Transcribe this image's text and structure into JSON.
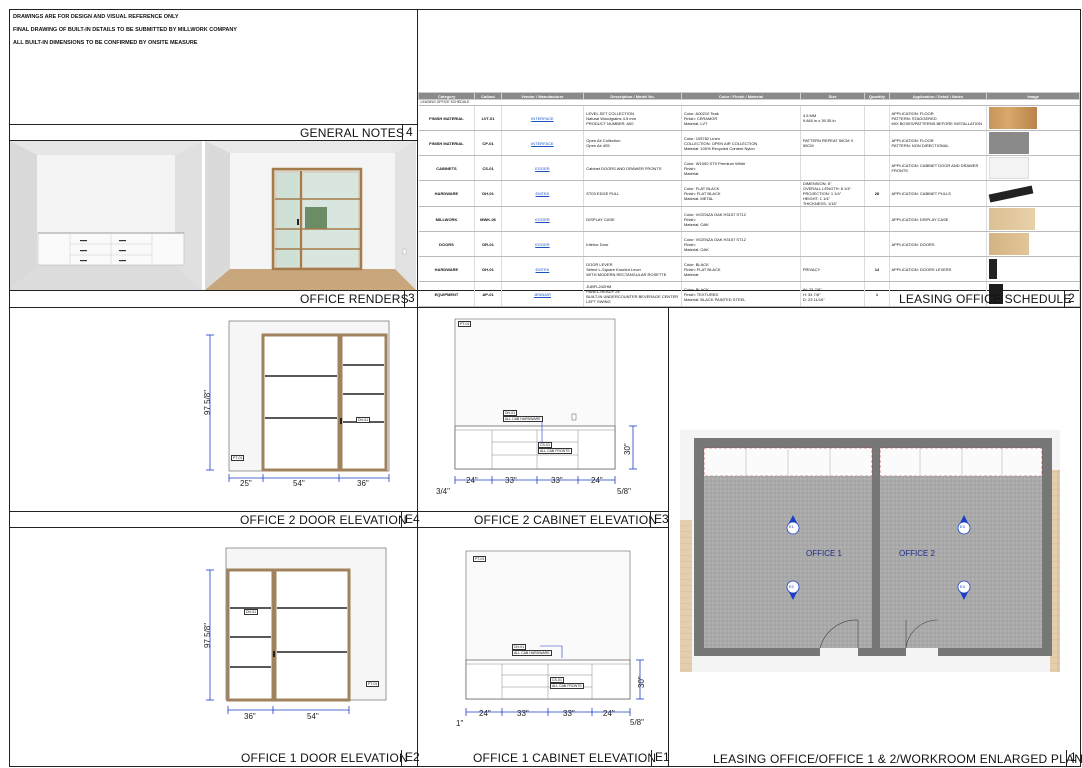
{
  "notes": {
    "line1": "DRAWINGS ARE FOR DESIGN AND VISUAL REFERENCE ONLY",
    "line2": "FINAL DRAWING OF BUILT-IN DETAILS TO BE SUBMITTED BY MILLWORK COMPANY",
    "line3": "ALL BUILT-IN DIMENSIONS TO BE CONFIRMED BY ONSITE MEASURE"
  },
  "panels": {
    "general_notes": {
      "title": "GENERAL NOTES",
      "num": "4"
    },
    "renders": {
      "title": "OFFICE RENDERS",
      "num": "3"
    },
    "schedule": {
      "title": "LEASING OFFICE SCHEDULE",
      "num": "2"
    },
    "o2_door": {
      "title": "OFFICE 2 DOOR ELEVATION",
      "num": "E4"
    },
    "o2_cab": {
      "title": "OFFICE 2 CABINET ELEVATION",
      "num": "E3"
    },
    "o1_door": {
      "title": "OFFICE 1 DOOR ELEVATION",
      "num": "E2"
    },
    "o1_cab": {
      "title": "OFFICE 1 CABINET ELEVATION",
      "num": "E1"
    },
    "plan": {
      "title": "LEASING OFFICE/OFFICE 1 & 2/WORKROOM ENLARGED PLAN",
      "num": "1"
    }
  },
  "schedule": {
    "headers": [
      "Category",
      "Callout",
      "Vendor / Manufacturer",
      "Description / Model No.",
      "Color / Finish / Material",
      "Size",
      "Quantity",
      "Application / Detail / Notes",
      "Image"
    ],
    "subtitle": "LEASING OFFICE SCHEDULE",
    "rows": [
      {
        "cat": "FINISH MATERIAL",
        "callout": "LVT-01",
        "vendor": "INTERFACE",
        "desc": "LEVEL SET COLLECTION\nNatural Woodgrains 4.5 mm\nPRODUCT NUMBER: A00",
        "color": "Color: A00210 Teak\nFinish: CERAMGR\nMaterial: LVT",
        "size": "4.5 MM\n9.845 in x 39.35 in",
        "qty": "",
        "notes": "APPLICATION: FLOOR\nPATTERN: STAGGERED\nMIX BOXES/PATTERNS BEFORE INSTALLATION",
        "img": "wood"
      },
      {
        "cat": "FINISH MATERIAL",
        "callout": "CP-01",
        "vendor": "INTERFACE",
        "desc": "Open Air Collection\nOpen Air 405",
        "color": "Color: 105782 Linen\nCOLLECTION: OPEN AIR COLLECTION\nMaterial: 100% Recycled Content Nylon",
        "size": "PATTERN REPEAT 50CM X 50CM",
        "qty": "",
        "notes": "APPLICATION: FLOOR\nPATTERN: NON DIRECTIONAL",
        "img": "carpet"
      },
      {
        "cat": "CABINETS",
        "callout": "CS-01",
        "vendor": "EGGER",
        "desc": "Cabinet DOORS AND DRAWER FRONTS",
        "color": "Color: W1000 ST9 Premium White\nFinish:\nMaterial:",
        "size": "",
        "qty": "",
        "notes": "APPLICATION: CABINET DOOR AND DRAWER FRONTS",
        "img": "white"
      },
      {
        "cat": "HARDWARE",
        "callout": "DH-01",
        "vendor": "EMTEK",
        "desc": "ST03 EDGE PULL",
        "color": "Color: FLAT BLACK\nFinish: FLAT BLACK\nMaterial: METAL",
        "size": "DIMENSION: 8\"\nOVERALL LENGTH: 8 1/4\"\nPROJECTION: 1 1/4\"\nHEIGHT: 1 1/4\"\nTHICKNESS: 1/16\"",
        "qty": "28",
        "notes": "APPLICATION: CABINET PULLS",
        "img": "pull"
      },
      {
        "cat": "MILLWORK",
        "callout": "MWK-06",
        "vendor": "EGGER",
        "desc": "DISPLAY CASE",
        "color": "Color: VICENZA OAK H3157 ST12\nFinish:\nMaterial: OAK",
        "size": "",
        "qty": "",
        "notes": "APPLICATION: DISPLAY CASE",
        "img": "oak"
      },
      {
        "cat": "DOORS",
        "callout": "DR-01",
        "vendor": "EGGER",
        "desc": "Interior Door",
        "color": "Color: VICENZA OAK H3157 ST12\nFinish:\nMaterial: OAK",
        "size": "",
        "qty": "",
        "notes": "APPLICATION: DOORS",
        "img": "oak2"
      },
      {
        "cat": "HARDWARE",
        "callout": "DH-01",
        "vendor": "EMTEK",
        "desc": "DOOR LEVER\nSelect L-Square Knurled Lever\nWITH MODERN RECTANGULAR ROSETTE",
        "color": "Color: BLACK\nFinish: FLAT BLACK\nMaterial:",
        "size": "PRIVACY",
        "qty": "14",
        "notes": "APPLICATION: DOORS LEVERS",
        "img": "lever"
      },
      {
        "cat": "EQUIPMENT",
        "callout": "AP-01",
        "vendor": "JENNAIR",
        "desc": "JUBFL242HM\nPANEL-READY 24\"\nBUILT-IN UNDERCOUNTER BEVERAGE CENTER\nLEFT SWING",
        "color": "Color: BLACK\nFinish: TEXTURED\nMaterial: BLACK PAINTED STEEL",
        "size": "W: 23-7/8\"\nH: 34 7/8\"\nD: 23 11/16\"",
        "qty": "1",
        "notes": "",
        "img": "fridge"
      }
    ]
  },
  "o2_door": {
    "height": "97 5/8\"",
    "d1": "25\"",
    "d2": "54\"",
    "d3": "36\"",
    "tag": "DH-01",
    "pt": "PT-01"
  },
  "o2_cab": {
    "d0": "3/4\"",
    "d1": "24\"",
    "d2": "33\"",
    "d3": "33\"",
    "d4": "24\"",
    "d5": "5/8\"",
    "h": "30\"",
    "tag1a": "DH-01",
    "tag1b": "ALL CAB HARDWARE",
    "tag2a": "CS-01",
    "tag2b": "ALL CAB FRONTS",
    "pt": "PT-01"
  },
  "o1_door": {
    "height": "97 5/8\"",
    "d1": "36\"",
    "d2": "54\"",
    "tag": "DH-01",
    "pt": "PT-01"
  },
  "o1_cab": {
    "d0": "1\"",
    "d1": "24\"",
    "d2": "33\"",
    "d3": "33\"",
    "d4": "24\"",
    "d5": "5/8\"",
    "h": "30\"",
    "tag1a": "DH-01",
    "tag1b": "ALL CAB HARDWARE",
    "tag2a": "CS-01",
    "tag2b": "ALL CAB FRONTS",
    "pt": "PT-01"
  },
  "plan": {
    "room1": "OFFICE 1",
    "room2": "OFFICE 2",
    "e1": "E1",
    "e2": "E2",
    "e3": "E3",
    "e4": "E4"
  }
}
